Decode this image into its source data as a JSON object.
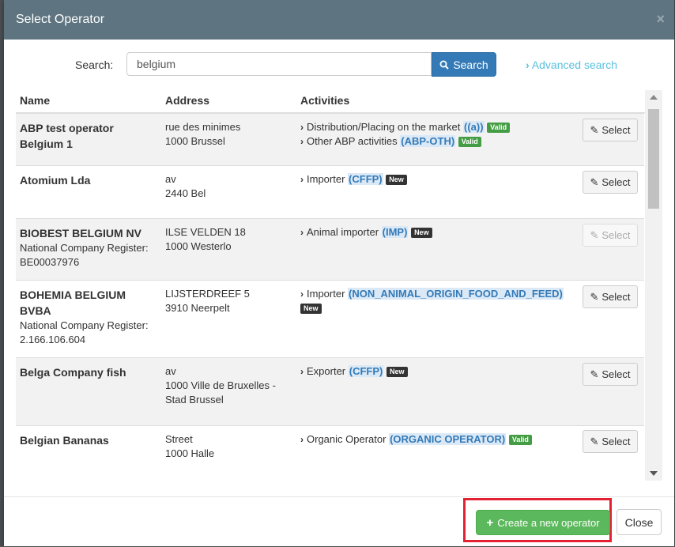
{
  "modal": {
    "title": "Select Operator",
    "close_symbol": "×"
  },
  "search": {
    "label": "Search:",
    "value": "belgium",
    "button_label": "Search",
    "advanced_link": "Advanced search"
  },
  "table": {
    "headers": {
      "name": "Name",
      "address": "Address",
      "activities": "Activities"
    },
    "select_label": "Select",
    "rows": [
      {
        "name": "ABP test operator Belgium 1",
        "detail": "",
        "address_line1": "rue des minimes",
        "address_line2": "1000 Brussel",
        "activities": [
          {
            "text": "Distribution/Placing on the market",
            "code": "((a))",
            "status": "Valid"
          },
          {
            "text": "Other ABP activities",
            "code": "(ABP-OTH)",
            "status": "Valid"
          }
        ],
        "select_enabled": true
      },
      {
        "name": "Atomium Lda",
        "detail": "",
        "address_line1": "av",
        "address_line2": "2440 Bel",
        "activities": [
          {
            "text": "Importer",
            "code": "(CFFP)",
            "status": "New"
          }
        ],
        "select_enabled": true
      },
      {
        "name": "BIOBEST BELGIUM NV",
        "detail": "National Company Register: BE00037976",
        "address_line1": "ILSE VELDEN 18",
        "address_line2": "1000 Westerlo",
        "activities": [
          {
            "text": "Animal importer",
            "code": "(IMP)",
            "status": "New"
          }
        ],
        "select_enabled": false
      },
      {
        "name": "BOHEMIA BELGIUM BVBA",
        "detail": "National Company Register: 2.166.106.604",
        "address_line1": "LIJSTERDREEF 5",
        "address_line2": "3910 Neerpelt",
        "activities": [
          {
            "text": "Importer",
            "code": "(NON_ANIMAL_ORIGIN_FOOD_AND_FEED)",
            "status": "New"
          }
        ],
        "select_enabled": true
      },
      {
        "name": "Belga Company fish",
        "detail": "",
        "address_line1": "av",
        "address_line2": "1000 Ville de Bruxelles - Stad Brussel",
        "activities": [
          {
            "text": "Exporter",
            "code": "(CFFP)",
            "status": "New"
          }
        ],
        "select_enabled": true
      },
      {
        "name": "Belgian Bananas",
        "detail": "",
        "address_line1": "Street",
        "address_line2": "1000 Halle",
        "activities": [
          {
            "text": "Organic Operator",
            "code": "(ORGANIC OPERATOR)",
            "status": "Valid"
          }
        ],
        "select_enabled": true
      }
    ]
  },
  "footer": {
    "create_label": "Create a new operator",
    "close_label": "Close"
  },
  "colors": {
    "header_bg": "#5e7480",
    "primary": "#337ab7",
    "success": "#5cb85c",
    "valid_badge": "#449d44",
    "new_badge": "#333333",
    "highlight": "#e32132"
  },
  "icons": {
    "search_button": "magnifier-icon",
    "advanced": "chevron-right-icon",
    "select": "edit-icon",
    "create": "plus-icon"
  }
}
